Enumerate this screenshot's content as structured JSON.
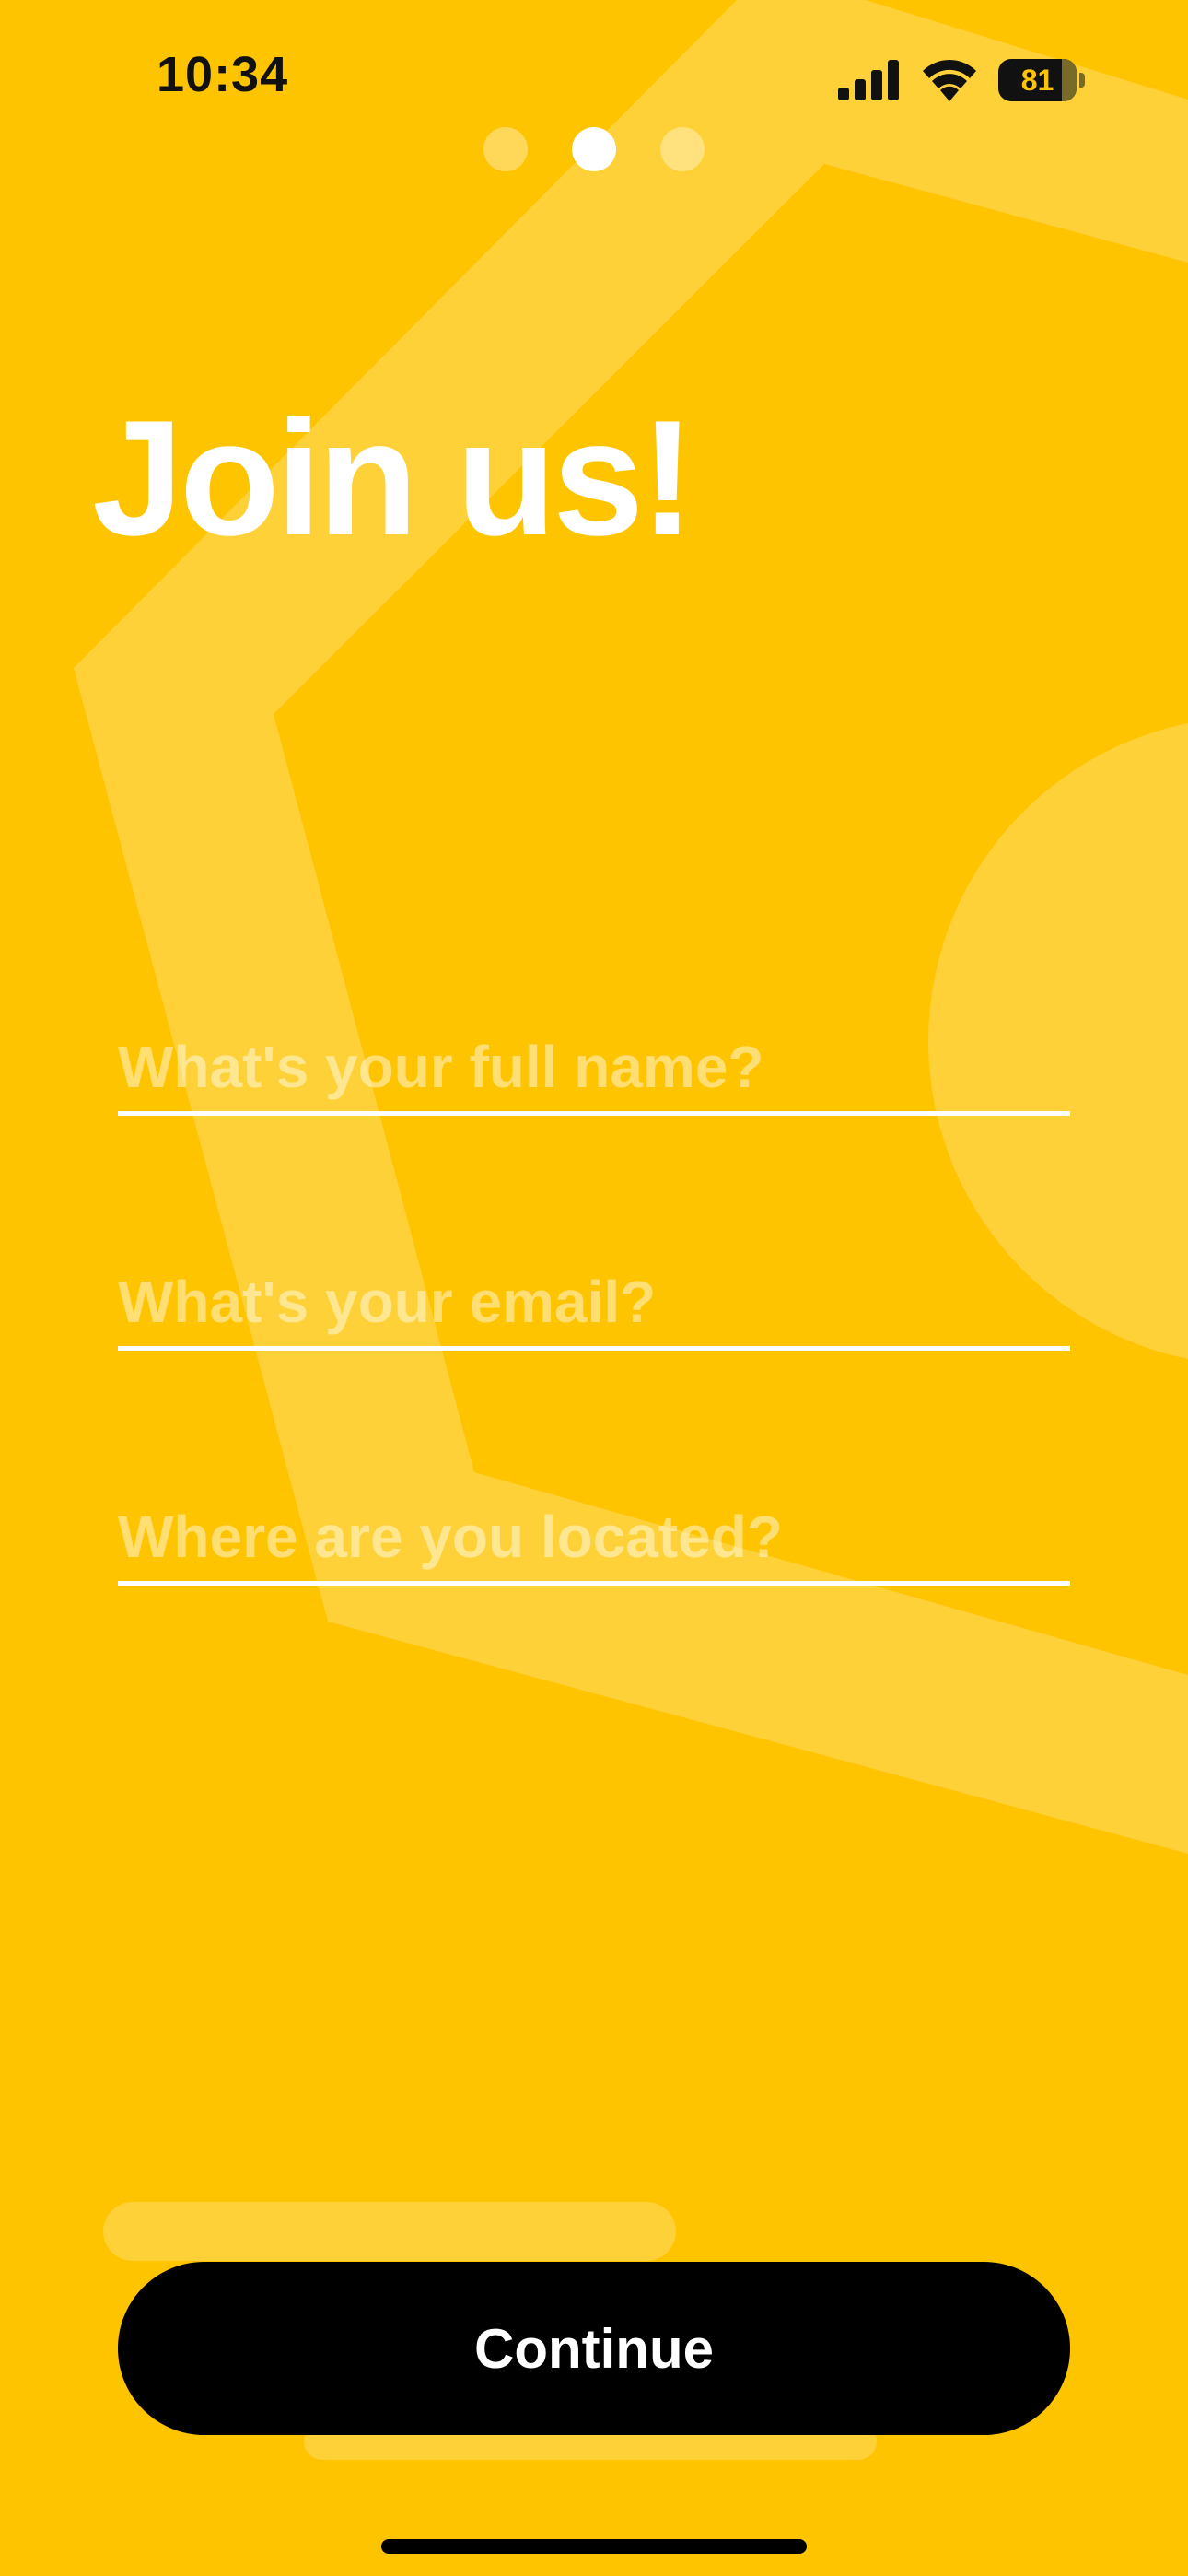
{
  "status_bar": {
    "time": "10:34",
    "battery_level": "81",
    "icons": [
      "cellular-signal-icon",
      "wifi-icon",
      "battery-icon"
    ]
  },
  "pager": {
    "total_pages": 3,
    "current_page": 2
  },
  "title": "Join us!",
  "form": {
    "full_name": {
      "placeholder": "What's your full name?",
      "value": ""
    },
    "email": {
      "placeholder": "What's your email?",
      "value": ""
    },
    "location": {
      "placeholder": "Where are you located?",
      "value": ""
    }
  },
  "continue_label": "Continue",
  "colors": {
    "background": "#FFC400",
    "accent_text": "#FFFFFF",
    "button": "#000000",
    "button_text": "#FFFFFF"
  }
}
